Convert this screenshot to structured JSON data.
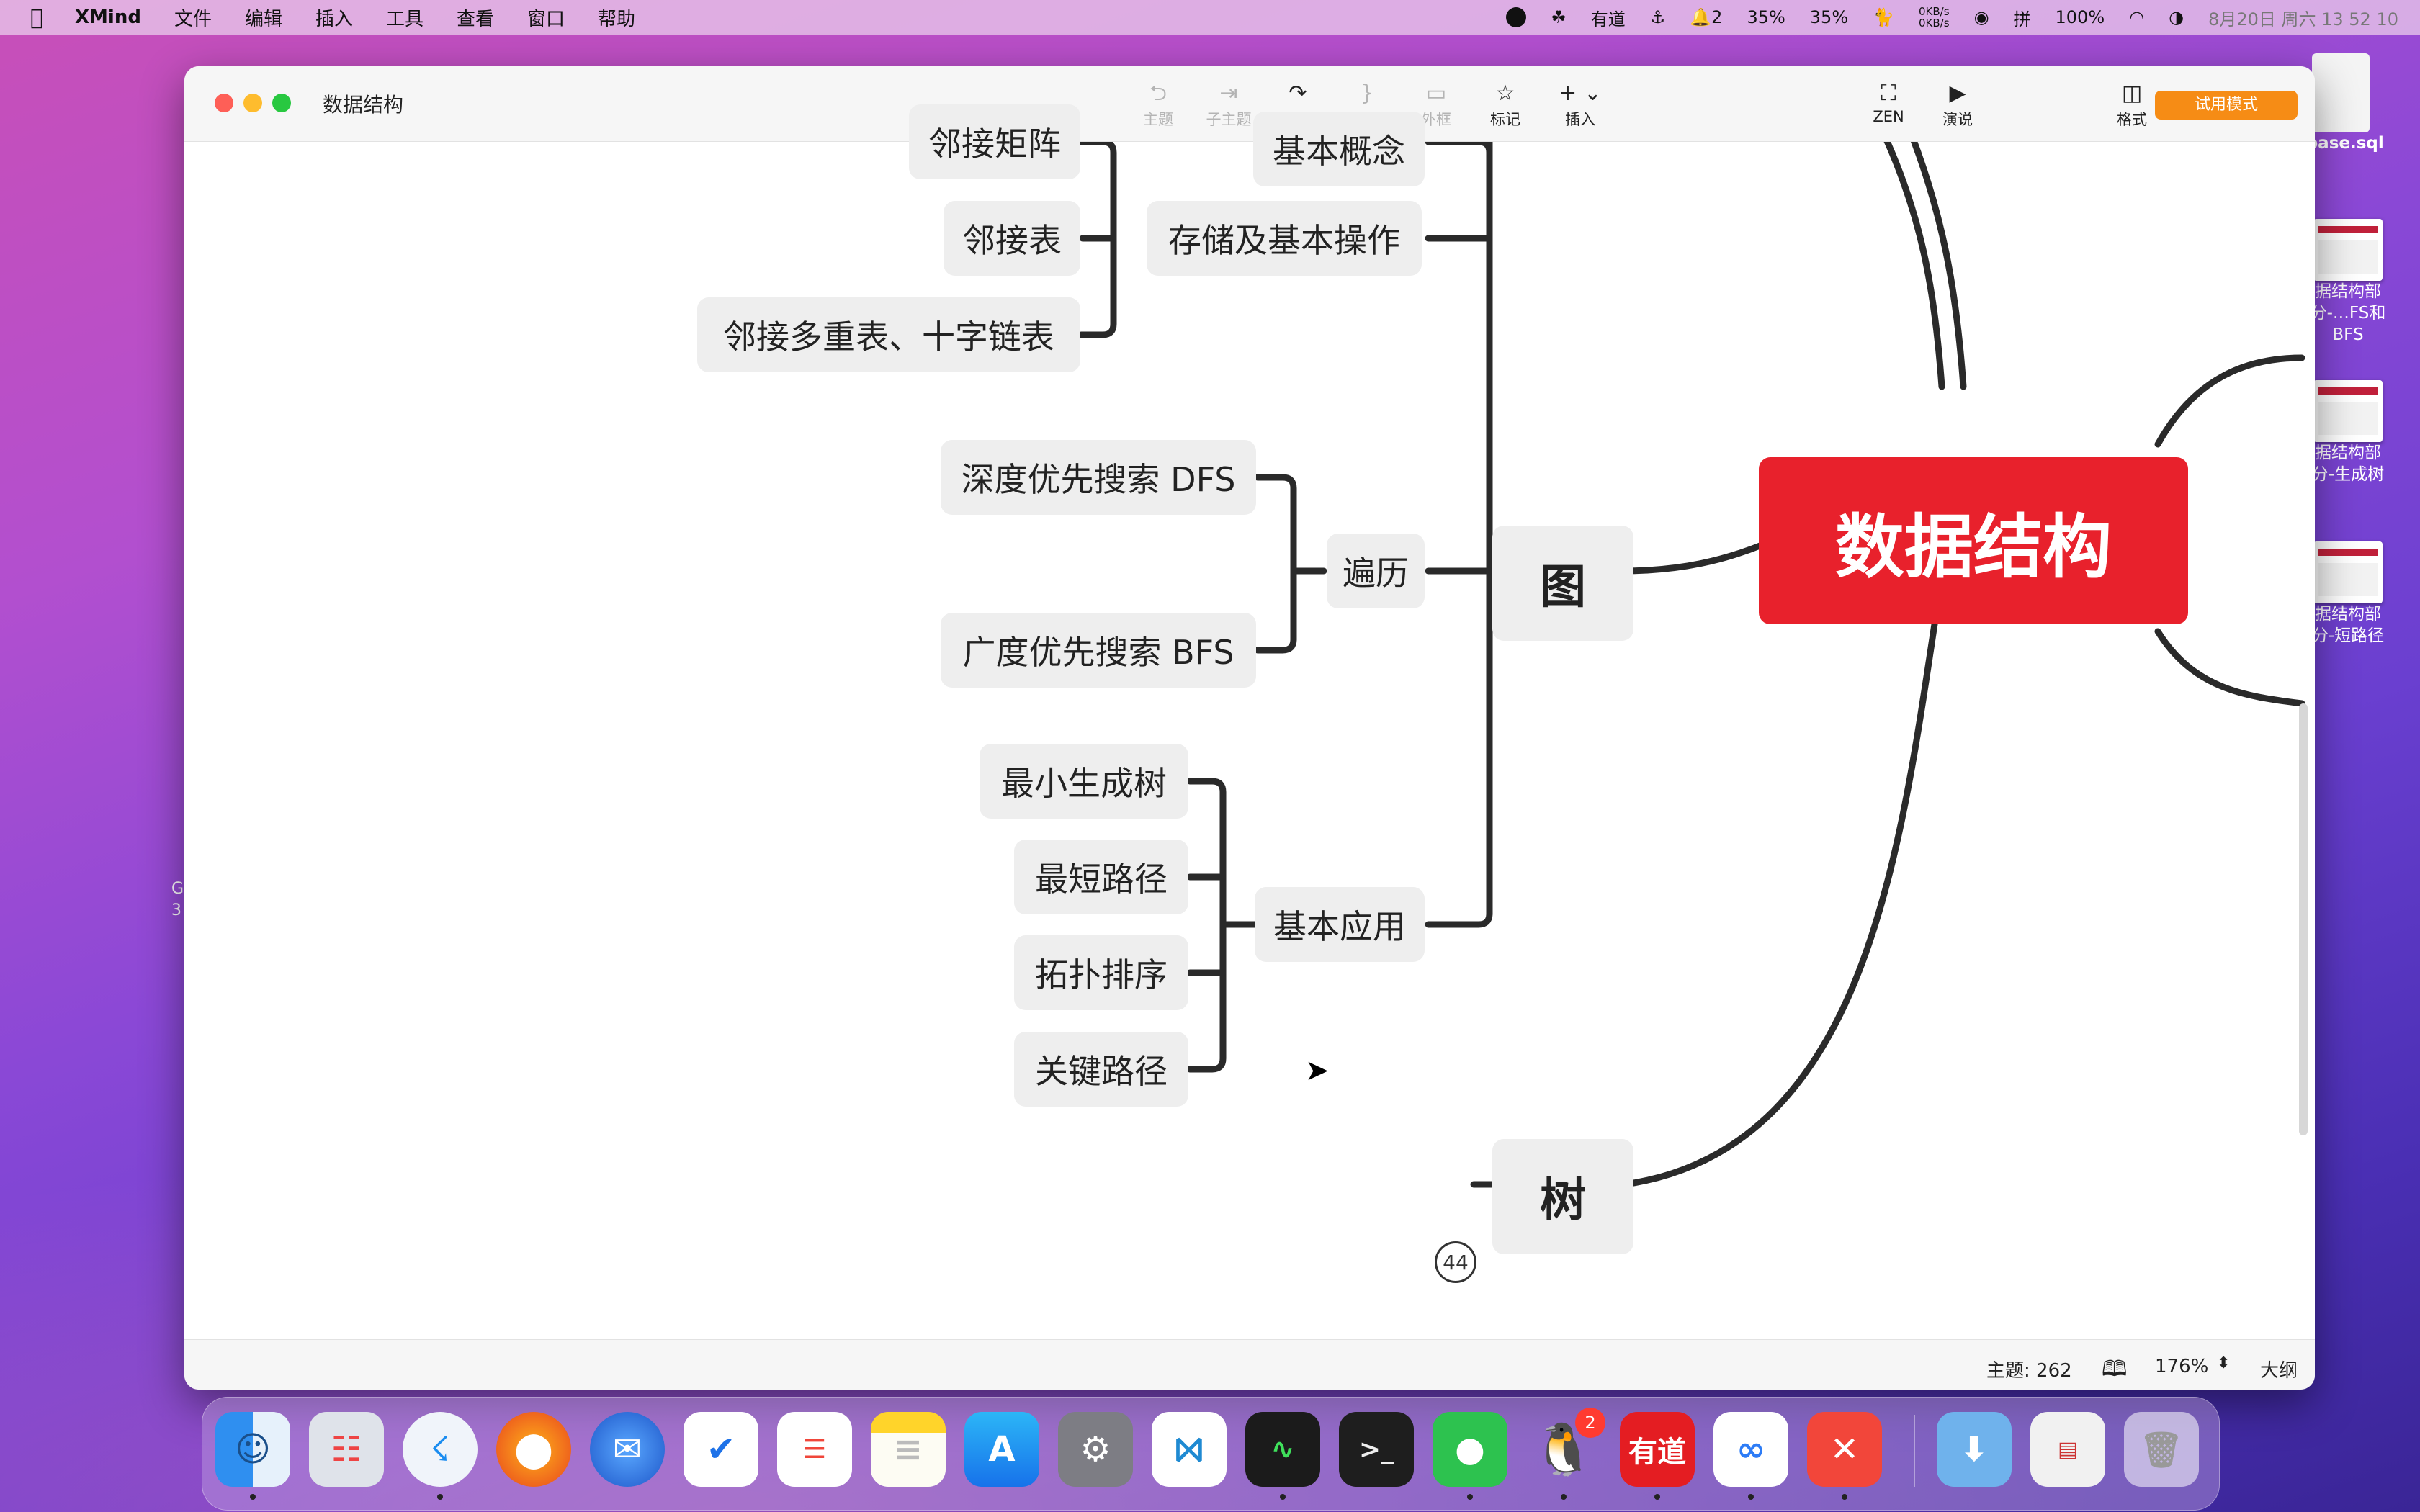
{
  "menubar": {
    "app_name": "XMind",
    "items": [
      "文件",
      "编辑",
      "插入",
      "工具",
      "查看",
      "窗口",
      "帮助"
    ],
    "youdao": "有道",
    "qq_count": "2",
    "cpu1": "35%",
    "cpu2": "35%",
    "net_up": "0KB/s",
    "net_down": "0KB/s",
    "ime": "拼",
    "battery": "100%",
    "datetime": "8月20日 周六  13 52 10"
  },
  "window": {
    "title": "数据结构",
    "toolbar": [
      {
        "label": "主题",
        "icon": "topic-icon",
        "enabled": false
      },
      {
        "label": "子主题",
        "icon": "subtopic-icon",
        "enabled": false
      },
      {
        "label": "联系",
        "icon": "relationship-icon",
        "enabled": true
      },
      {
        "label": "概要",
        "icon": "summary-icon",
        "enabled": false
      },
      {
        "label": "外框",
        "icon": "boundary-icon",
        "enabled": false
      },
      {
        "label": "标记",
        "icon": "star-icon",
        "enabled": true
      },
      {
        "label": "插入",
        "icon": "plus-icon",
        "enabled": true
      },
      {
        "label": "ZEN",
        "icon": "zen-icon",
        "enabled": true
      },
      {
        "label": "演说",
        "icon": "pitch-icon",
        "enabled": true
      },
      {
        "label": "格式",
        "icon": "format-icon",
        "enabled": true
      }
    ],
    "trial_button": "试用模式"
  },
  "mindmap": {
    "root": "数据结构",
    "graph": "图",
    "tree": "树",
    "tree_collapsed_count": "44",
    "branches": {
      "basic_concept": "基本概念",
      "storage": "存储及基本操作",
      "traversal": "遍历",
      "application": "基本应用"
    },
    "storage_children": [
      "邻接矩阵",
      "邻接表",
      "邻接多重表、十字链表"
    ],
    "traversal_children": [
      "深度优先搜索 DFS",
      "广度优先搜索 BFS"
    ],
    "application_children": [
      "最小生成树",
      "最短路径",
      "拓扑排序",
      "关键路径"
    ]
  },
  "statusbar": {
    "topic_count": "主题: 262",
    "zoom": "176%",
    "outline": "大纲"
  },
  "desktop": {
    "files": [
      "_base.sql",
      "据结构部分-…FS和BFS",
      "据结构部分-生成树",
      "据结构部分-短路径"
    ],
    "left_partial": "G\n3"
  },
  "dock": {
    "qq_badge": "2",
    "youdao_label": "有道",
    "apps": [
      "finder-icon",
      "launchpad-icon",
      "safari-icon",
      "firefox-icon",
      "thunderbird-icon",
      "todo-icon",
      "reminders-icon",
      "notes-icon",
      "appstore-icon",
      "settings-icon",
      "vscode-icon",
      "activity-monitor-icon",
      "terminal-icon",
      "wechat-icon",
      "qq-icon",
      "youdao-icon",
      "baidunetdisk-icon",
      "xmind-icon",
      "downloads-icon",
      "screenshot-icon",
      "trash-icon"
    ]
  }
}
